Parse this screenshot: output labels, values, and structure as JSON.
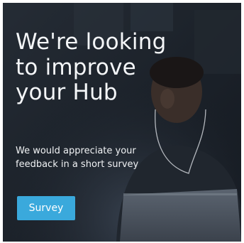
{
  "promo": {
    "headline_lines": [
      "We're looking",
      "to improve",
      "your Hub"
    ],
    "subtext_lines": [
      "We would appreciate your",
      "feedback in a short survey"
    ],
    "button_label": "Survey"
  },
  "colors": {
    "card_background": "#1b2129",
    "text": "#f4f6f8",
    "button": "#3aa9dc"
  }
}
